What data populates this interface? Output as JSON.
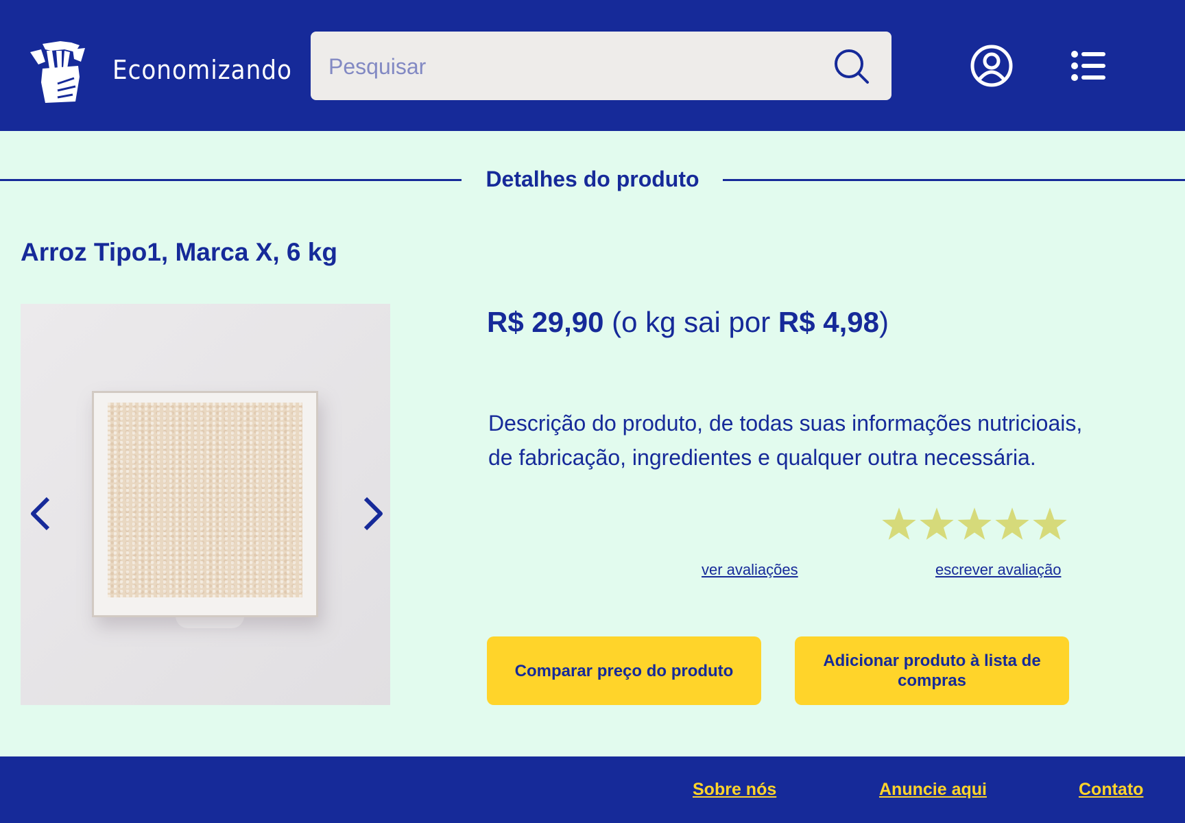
{
  "header": {
    "brand_name": "Economizando",
    "search": {
      "placeholder": "Pesquisar",
      "value": ""
    },
    "icons": [
      "logo-icon",
      "search-icon",
      "user-icon",
      "menu-icon"
    ]
  },
  "section": {
    "title": "Detalhes do produto"
  },
  "product": {
    "title": "Arroz Tipo1, Marca X, 6 kg",
    "price": "R$ 29,90",
    "per_kg_prefix": "(o kg sai por",
    "per_kg_price": "R$ 4,98",
    "per_kg_suffix": ")",
    "description": "Descrição do produto, de todas suas informações nutricioais, de fabricação, ingredientes e qualquer outra necessária.",
    "rating": {
      "stars_filled": 5,
      "stars_total": 5
    },
    "view_reviews_label": "ver avaliações",
    "write_review_label": "escrever avaliação",
    "compare_button_label": "Comparar preço do produto",
    "add_to_list_button_label": "Adicionar produto à lista de compras"
  },
  "footer": {
    "links": [
      "Sobre nós",
      "Anuncie aqui",
      "Contato"
    ]
  },
  "colors": {
    "primary": "#162A99",
    "background": "#E2FBEE",
    "accent": "#FFD42A",
    "star": "#D6DA7A",
    "search_bg": "#EEECEA"
  }
}
